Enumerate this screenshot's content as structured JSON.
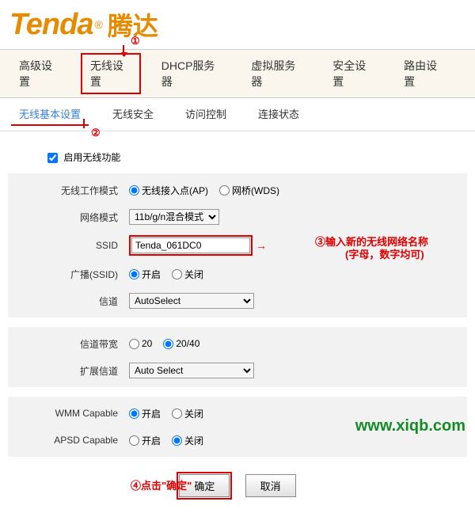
{
  "logo": {
    "brand": "Tenda",
    "cn": "腾达"
  },
  "main_nav": {
    "items": [
      "高级设置",
      "无线设置",
      "DHCP服务器",
      "虚拟服务器",
      "安全设置",
      "路由设置"
    ],
    "highlighted_index": 1
  },
  "sub_nav": {
    "items": [
      "无线基本设置",
      "无线安全",
      "访问控制",
      "连接状态"
    ],
    "active_index": 0
  },
  "callouts": {
    "c1": "①",
    "c2": "②",
    "c3_prefix": "③",
    "c3_text": "输入新的无线网络名称",
    "c3_sub": "(字母，数字均可)",
    "c4": "④点击\"确定\""
  },
  "form": {
    "enable_label": "启用无线功能",
    "enable_checked": true,
    "rows": {
      "work_mode": {
        "label": "无线工作模式",
        "options": [
          {
            "label": "无线接入点(AP)",
            "checked": true
          },
          {
            "label": "网桥(WDS)",
            "checked": false
          }
        ]
      },
      "net_mode": {
        "label": "网络模式",
        "value": "11b/g/n混合模式"
      },
      "ssid": {
        "label": "SSID",
        "value": "Tenda_061DC0"
      },
      "broadcast": {
        "label": "广播(SSID)",
        "options": [
          {
            "label": "开启",
            "checked": true
          },
          {
            "label": "关闭",
            "checked": false
          }
        ]
      },
      "channel": {
        "label": "信道",
        "value": "AutoSelect"
      },
      "bandwidth": {
        "label": "信道带宽",
        "options": [
          {
            "label": "20",
            "checked": false
          },
          {
            "label": "20/40",
            "checked": true
          }
        ]
      },
      "ext_channel": {
        "label": "扩展信道",
        "value": "Auto Select"
      },
      "wmm": {
        "label": "WMM Capable",
        "options": [
          {
            "label": "开启",
            "checked": true
          },
          {
            "label": "关闭",
            "checked": false
          }
        ]
      },
      "apsd": {
        "label": "APSD Capable",
        "options": [
          {
            "label": "开启",
            "checked": false
          },
          {
            "label": "关闭",
            "checked": true
          }
        ]
      }
    }
  },
  "buttons": {
    "ok": "确定",
    "cancel": "取消"
  },
  "watermark": "www.xiqb.com"
}
